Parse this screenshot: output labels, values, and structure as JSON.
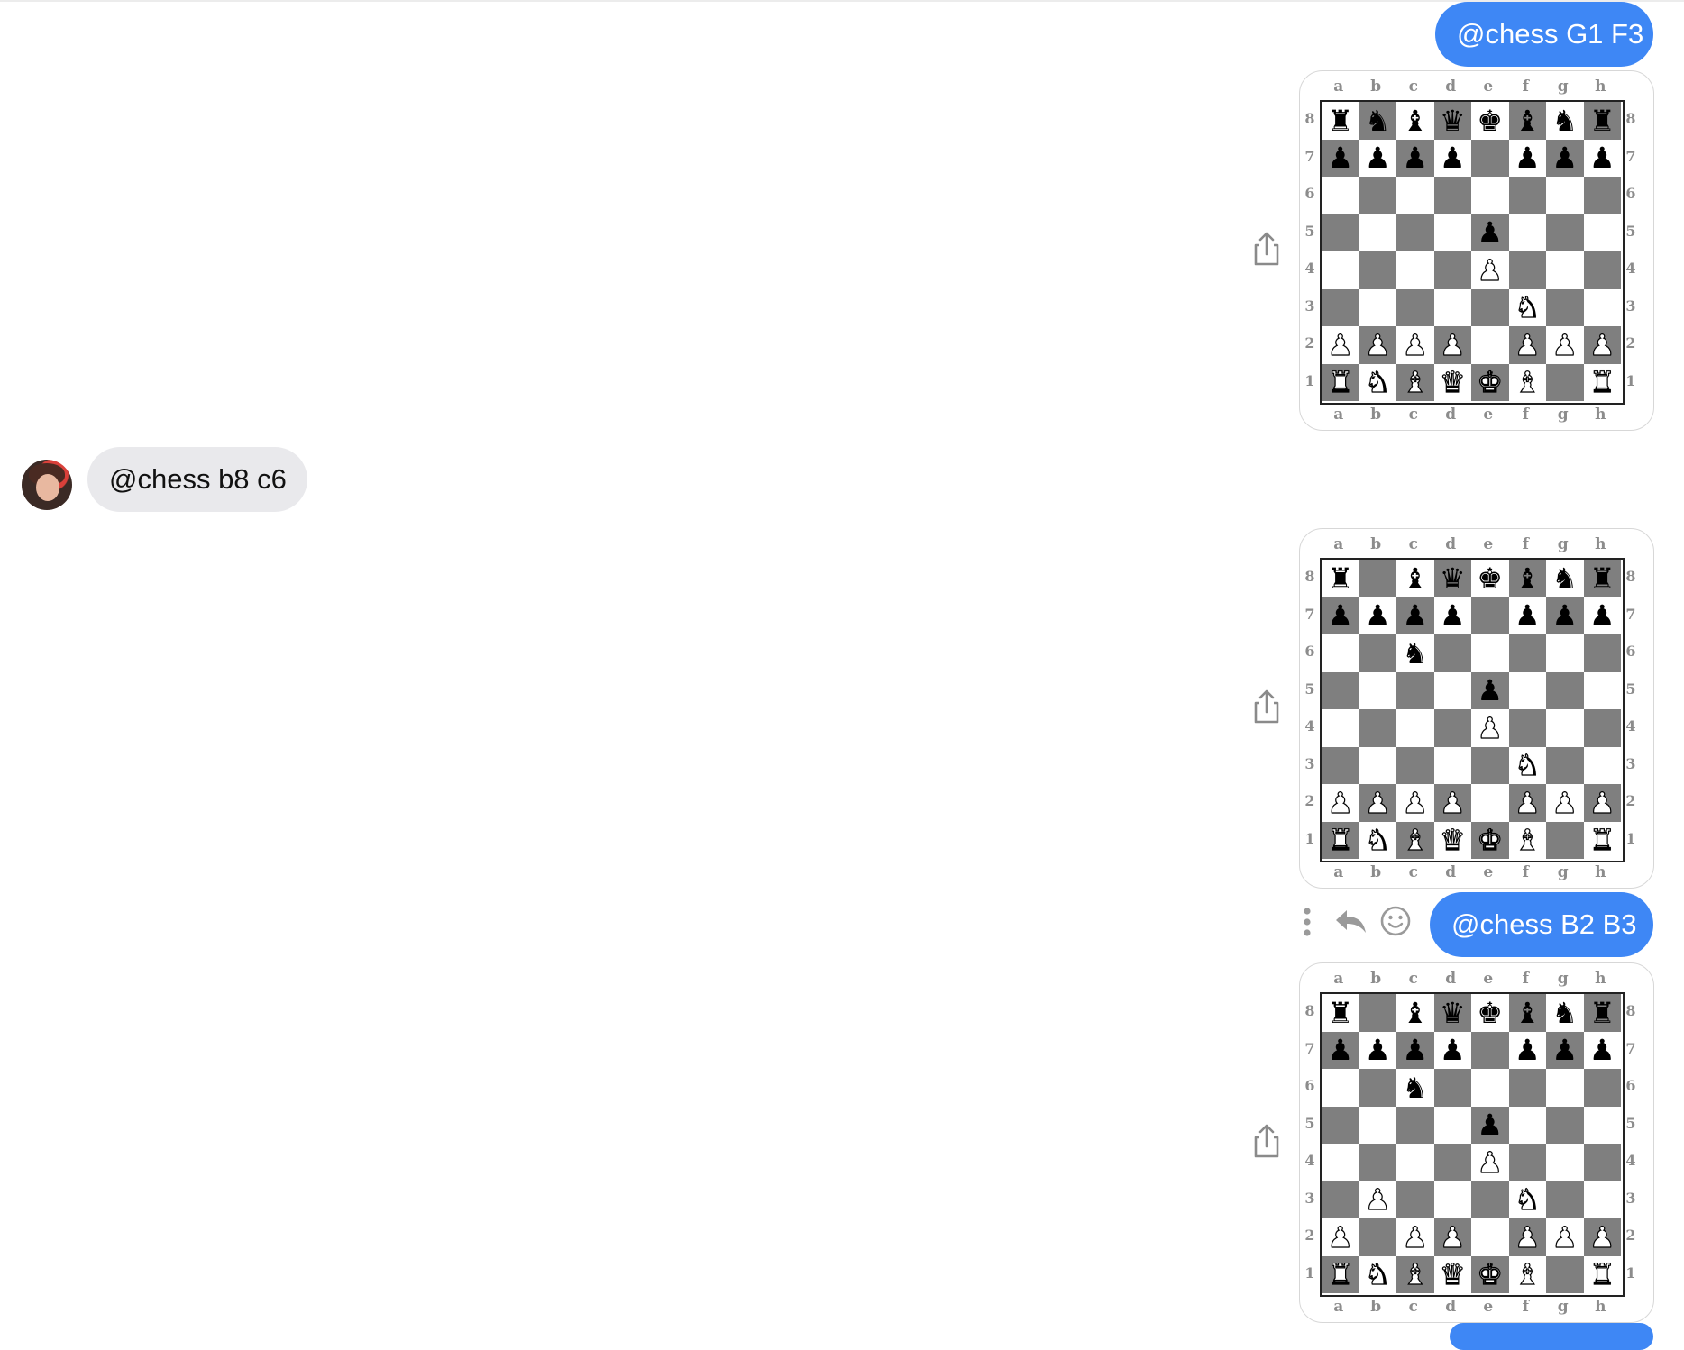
{
  "messages": {
    "sent_1": "@chess G1 F3",
    "received_1": "@chess b8 c6",
    "sent_2": "@chess B2 B3"
  },
  "board_labels": {
    "files": [
      "a",
      "b",
      "c",
      "d",
      "e",
      "f",
      "g",
      "h"
    ],
    "ranks": [
      "8",
      "7",
      "6",
      "5",
      "4",
      "3",
      "2",
      "1"
    ]
  },
  "boards": [
    {
      "rows": [
        "rnbqkbnr",
        "pppp.ppp",
        "........",
        "....p...",
        "....P...",
        ".....N..",
        "PPPP.PPP",
        "RNBQKB.R"
      ]
    },
    {
      "rows": [
        "r.bqkbnr",
        "pppp.ppp",
        "..n.....",
        "....p...",
        "....P...",
        ".....N..",
        "PPPP.PPP",
        "RNBQKB.R"
      ]
    },
    {
      "rows": [
        "r.bqkbnr",
        "pppp.ppp",
        "..n.....",
        "....p...",
        "....P...",
        ".P...N..",
        "P.PP.PPP",
        "RNBQKB.R"
      ]
    }
  ],
  "colors": {
    "sent_bubble": "#3e87f5",
    "received_bubble": "#e9e9ec",
    "dark_square": "#7f7f7f",
    "light_square": "#ffffff"
  },
  "icons": {
    "share": "share-icon",
    "more": "more-vertical-icon",
    "reply": "reply-icon",
    "react": "emoji-icon"
  }
}
